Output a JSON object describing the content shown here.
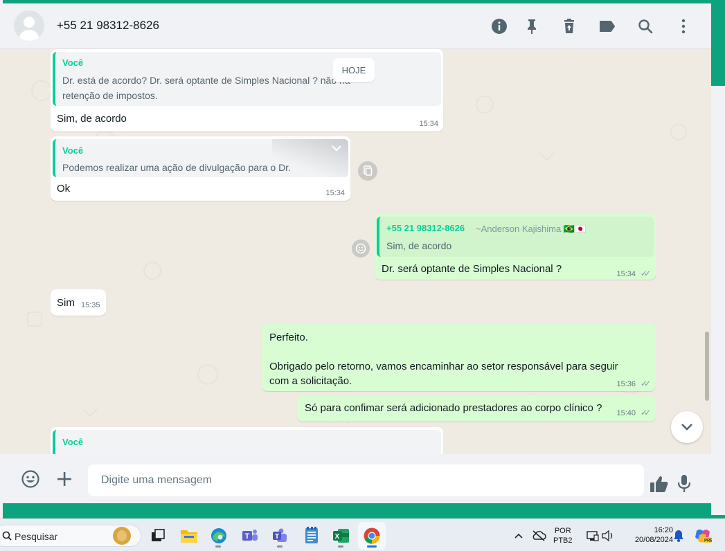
{
  "colors": {
    "accent": "#06cf9c",
    "outgoing_bubble": "#d9fdd3",
    "incoming_bubble": "#ffffff",
    "chat_bg": "#efeae2",
    "header_bg": "#f0f2f5"
  },
  "header": {
    "contact": "+55 21 98312-8626",
    "icons": [
      "info-icon",
      "pin-icon",
      "trash-icon",
      "label-icon",
      "search-icon",
      "menu-icon"
    ]
  },
  "chat": {
    "day_label": "HOJE",
    "messages": [
      {
        "quote_name": "Você",
        "quote_text_1": "Dr. está de acordo? Dr. será optante de Simples Nacional ? não há",
        "quote_text_2": "retenção de impostos.",
        "text": "Sim, de acordo",
        "time": "15:34"
      },
      {
        "quote_name": "Você",
        "quote_text_1": "Podemos realizar uma ação de divulgação para o Dr.",
        "text": "Ok",
        "time": "15:34"
      },
      {
        "quote_number": "+55 21 98312-8626",
        "quote_author": "~Anderson Kajishima 🇧🇷🇯🇵",
        "quote_text_1": "Sim, de acordo",
        "text": "Dr. será optante de Simples Nacional ?",
        "time": "15:34"
      },
      {
        "text": "Sim",
        "time": "15:35"
      },
      {
        "text_1": "Perfeito.",
        "text_2": "Obrigado pelo retorno, vamos encaminhar ao setor responsável para seguir",
        "text_3": "com a solicitação.",
        "time": "15:36"
      },
      {
        "text": "Só para confimar será adicionado prestadores ao corpo clínico ?",
        "time": "15:40"
      },
      {
        "quote_name": "Você"
      }
    ]
  },
  "footer": {
    "placeholder": "Digite uma mensagem"
  },
  "taskbar": {
    "search_label": "Pesquisar",
    "lang_1": "POR",
    "lang_2": "PTB2",
    "time": "16:20",
    "date": "20/08/2024",
    "apps": [
      "task-view-icon",
      "file-explorer-icon",
      "edge-icon",
      "teams-icon",
      "teams-work-icon",
      "notepad-icon",
      "excel-icon",
      "chrome-icon"
    ]
  }
}
